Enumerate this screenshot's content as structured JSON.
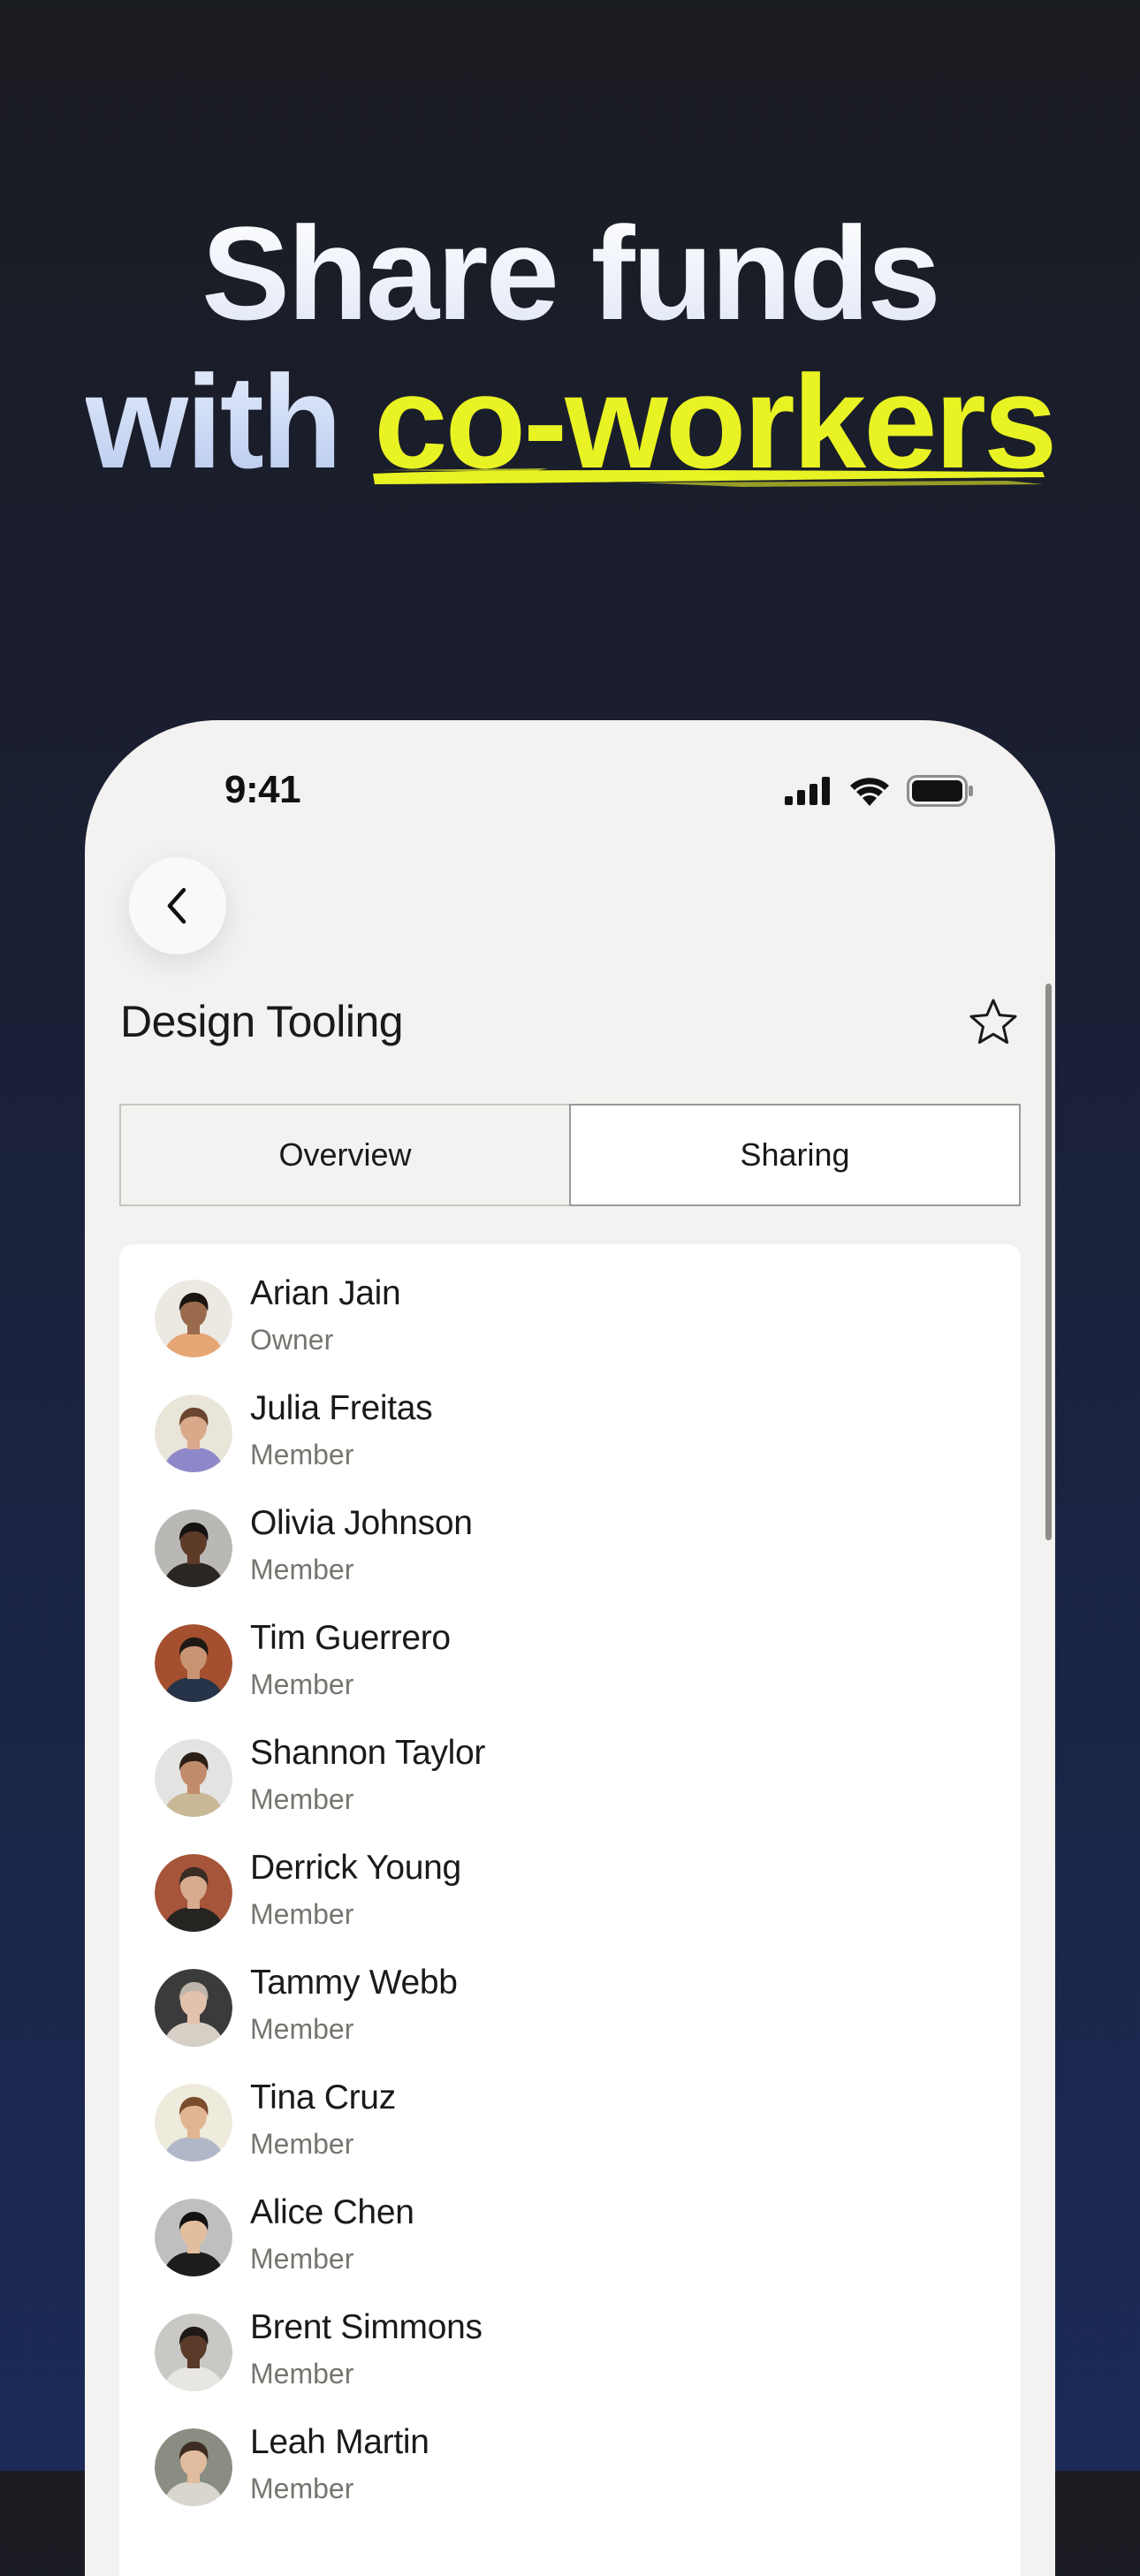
{
  "headline": {
    "line1": "Share funds",
    "line2_prefix": "with",
    "line2_accent": "co-workers"
  },
  "colors": {
    "accent": "#e9f323",
    "background_top": "#1b1c21",
    "background_bottom": "#1b2a57",
    "phone_surface": "#f3f2f0"
  },
  "status_bar": {
    "time": "9:41",
    "icons": [
      "cellular-signal-icon",
      "wifi-icon",
      "battery-icon"
    ]
  },
  "page": {
    "title": "Design Tooling",
    "favorite_icon": "star-outline-icon",
    "back_icon": "chevron-left-icon"
  },
  "tabs": [
    {
      "label": "Overview",
      "selected": false
    },
    {
      "label": "Sharing",
      "selected": true
    }
  ],
  "members": [
    {
      "name": "Arian Jain",
      "role": "Owner",
      "avatar_bg": "#ece9e3",
      "skin": "#9a6a4c",
      "hair": "#1b1512",
      "shirt": "#e6a674"
    },
    {
      "name": "Julia Freitas",
      "role": "Member",
      "avatar_bg": "#e9e5d9",
      "skin": "#d9a98a",
      "hair": "#6b4530",
      "shirt": "#8e87c9"
    },
    {
      "name": "Olivia Johnson",
      "role": "Member",
      "avatar_bg": "#b9b8b5",
      "skin": "#5e3a29",
      "hair": "#151212",
      "shirt": "#2a2623"
    },
    {
      "name": "Tim Guerrero",
      "role": "Member",
      "avatar_bg": "#a4502f",
      "skin": "#c89474",
      "hair": "#1e1915",
      "shirt": "#263349"
    },
    {
      "name": "Shannon Taylor",
      "role": "Member",
      "avatar_bg": "#e3e3e1",
      "skin": "#c08c6b",
      "hair": "#2b1e17",
      "shirt": "#c9b896"
    },
    {
      "name": "Derrick Young",
      "role": "Member",
      "avatar_bg": "#a6553b",
      "skin": "#d6ab8e",
      "hair": "#3a2c22",
      "shirt": "#262421"
    },
    {
      "name": "Tammy Webb",
      "role": "Member",
      "avatar_bg": "#3b3b3b",
      "skin": "#e3c2ad",
      "hair": "#bdb4ab",
      "shirt": "#d5cfc5"
    },
    {
      "name": "Tina Cruz",
      "role": "Member",
      "avatar_bg": "#eeeadc",
      "skin": "#e0b591",
      "hair": "#7a4c2c",
      "shirt": "#b0b7c8"
    },
    {
      "name": "Alice Chen",
      "role": "Member",
      "avatar_bg": "#bfbfbf",
      "skin": "#e2be9e",
      "hair": "#141111",
      "shirt": "#1f1d1c"
    },
    {
      "name": "Brent Simmons",
      "role": "Member",
      "avatar_bg": "#c9c8c5",
      "skin": "#5a3b2a",
      "hair": "#1e1916",
      "shirt": "#e7e6e2"
    },
    {
      "name": "Leah Martin",
      "role": "Member",
      "avatar_bg": "#8a8e82",
      "skin": "#e1bc9f",
      "hair": "#3b2b20",
      "shirt": "#d9d6cf"
    }
  ]
}
